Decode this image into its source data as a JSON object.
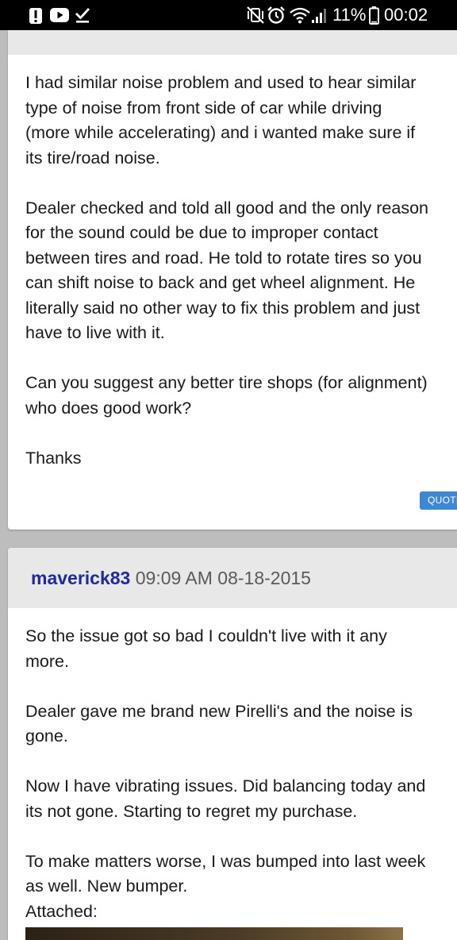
{
  "status_bar": {
    "battery_percent_label": "11%",
    "time": "00:02",
    "icons": [
      "alert-icon",
      "youtube-icon",
      "download-done-icon",
      "vibrate-mute-icon",
      "alarm-icon",
      "wifi-icon",
      "signal-icon",
      "battery-icon"
    ]
  },
  "posts": [
    {
      "paragraphs": [
        [
          "I had similar noise problem and used to hear similar",
          "type of noise from front side of car while driving",
          "(more while accelerating) and i wanted make sure if",
          "its tire/road noise."
        ],
        [
          "Dealer checked and told all good and the only reason",
          "for the sound could be due to improper contact",
          "between tires and road. He told to rotate tires so you",
          "can shift noise to back and get wheel alignment. He",
          "literally said no other way to fix this problem and just",
          "have to live with it."
        ],
        [
          "Can you suggest any better tire shops (for alignment)",
          "who does good work?"
        ],
        [
          "Thanks"
        ]
      ],
      "quote_label": "QUOTE"
    },
    {
      "author": "maverick83",
      "timestamp": "09:09 AM 08-18-2015",
      "paragraphs": [
        [
          "So the issue got so bad I couldn't live with it any",
          "more."
        ],
        [
          "Dealer gave me brand new Pirelli's and the noise is",
          "gone."
        ],
        [
          "Now I have vibrating issues. Did balancing today and",
          "its not gone. Starting to regret my purchase."
        ],
        [
          "To make matters worse, I was bumped into last week",
          "as well. New bumper.",
          "Attached:"
        ]
      ]
    }
  ],
  "colors": {
    "author": "#1f2aa0",
    "quote_button": "#3f86d6",
    "header_bg": "#e8e8e8",
    "page_bg": "#bdbdbd"
  }
}
